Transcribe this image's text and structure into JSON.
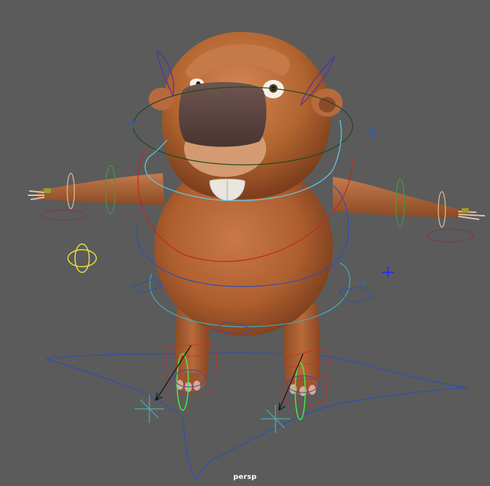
{
  "viewport": {
    "camera_label": "persp",
    "background_color": "#5b5b5b"
  },
  "character": {
    "fur_color": "#b5653a",
    "nose_color": "#5a3f3b",
    "teeth_color": "#e8e6df"
  },
  "rig_controls": {
    "colors": {
      "main": "#2c4fb8",
      "hips": "#3bb0c8",
      "head": "#244a22",
      "neck": "#66c8e0",
      "chest": "#c0281e",
      "ears": "#5a2fa0",
      "arm_fk": "#3f9a3f",
      "wrist": "#e8b890",
      "ik_foot": "#e02020",
      "heel": "#44ee44",
      "pole": "#4bb0b0",
      "ik_pv_arm": "#7a3a5a",
      "eye_target": "#e8e040",
      "locator": "#3030e0"
    }
  }
}
